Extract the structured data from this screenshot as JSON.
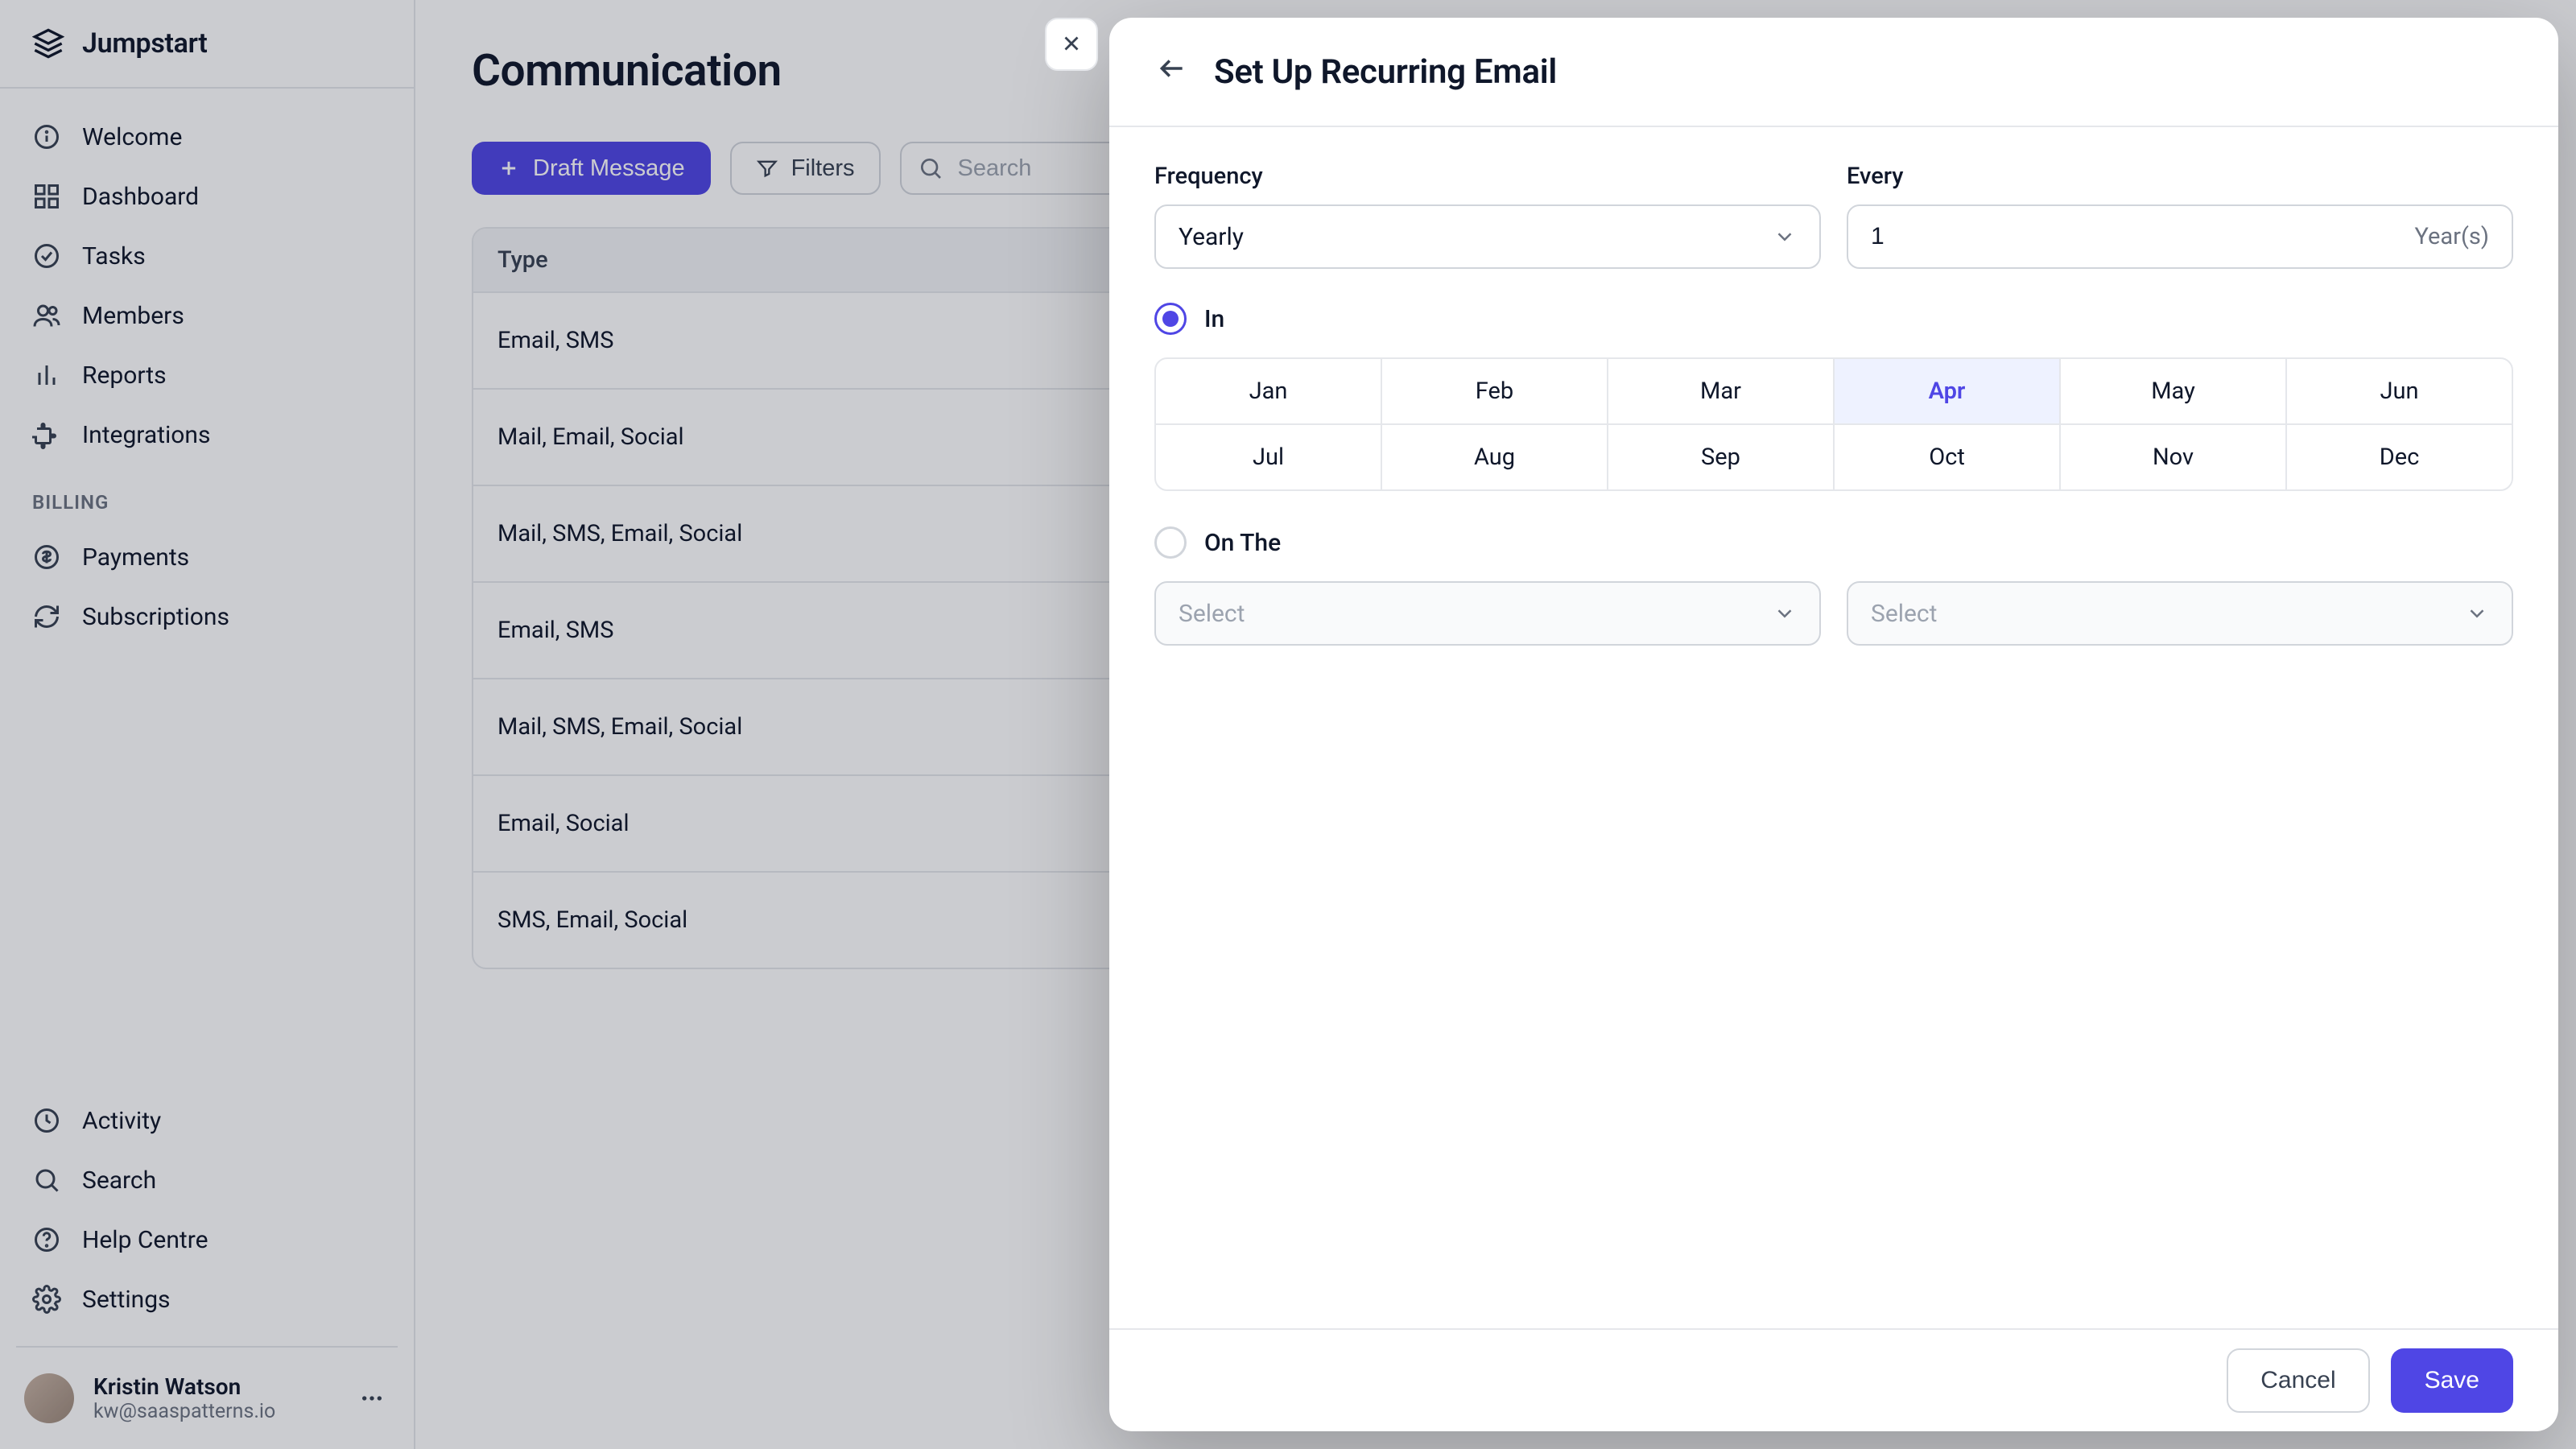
{
  "brand": {
    "name": "Jumpstart"
  },
  "sidebar": {
    "main": [
      {
        "label": "Welcome",
        "icon": "info"
      },
      {
        "label": "Dashboard",
        "icon": "grid"
      },
      {
        "label": "Tasks",
        "icon": "check"
      },
      {
        "label": "Members",
        "icon": "users"
      },
      {
        "label": "Reports",
        "icon": "bars"
      },
      {
        "label": "Integrations",
        "icon": "puzzle"
      }
    ],
    "billing_label": "BILLING",
    "billing": [
      {
        "label": "Payments",
        "icon": "dollar"
      },
      {
        "label": "Subscriptions",
        "icon": "refresh"
      }
    ],
    "bottom": [
      {
        "label": "Activity",
        "icon": "clock"
      },
      {
        "label": "Search",
        "icon": "search"
      },
      {
        "label": "Help Centre",
        "icon": "help"
      },
      {
        "label": "Settings",
        "icon": "gear"
      }
    ],
    "user": {
      "name": "Kristin Watson",
      "email": "kw@saaspatterns.io"
    }
  },
  "main": {
    "title": "Communication",
    "draft_button": "Draft Message",
    "filters_button": "Filters",
    "search_placeholder": "Search",
    "table": {
      "header": "Type",
      "rows": [
        "Email, SMS",
        "Mail, Email, Social",
        "Mail, SMS, Email, Social",
        "Email, SMS",
        "Mail, SMS, Email, Social",
        "Email, Social",
        "SMS, Email, Social"
      ]
    }
  },
  "drawer": {
    "title": "Set Up Recurring Email",
    "frequency_label": "Frequency",
    "frequency_value": "Yearly",
    "every_label": "Every",
    "every_value": "1",
    "every_suffix": "Year(s)",
    "in_label": "In",
    "on_the_label": "On The",
    "months": [
      "Jan",
      "Feb",
      "Mar",
      "Apr",
      "May",
      "Jun",
      "Jul",
      "Aug",
      "Sep",
      "Oct",
      "Nov",
      "Dec"
    ],
    "selected_month": "Apr",
    "select_placeholder": "Select",
    "cancel": "Cancel",
    "save": "Save"
  }
}
